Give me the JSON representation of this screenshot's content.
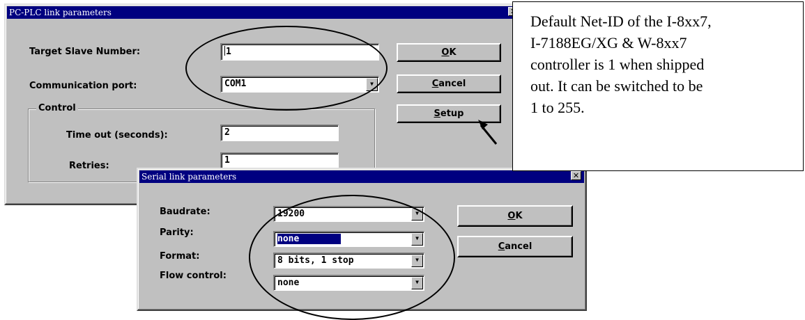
{
  "main_dialog": {
    "title": "PC-PLC link parameters",
    "target_slave_label": "Target Slave Number:",
    "target_slave_value": "1",
    "comm_port_label": "Communication port:",
    "comm_port_value": "COM1",
    "control_group_label": "Control",
    "timeout_label": "Time out (seconds):",
    "timeout_value": "2",
    "retries_label": "Retries:",
    "retries_value": "1",
    "ok_button": {
      "accel": "O",
      "rest": "K"
    },
    "cancel_button": {
      "accel": "C",
      "rest": "ancel"
    },
    "setup_button": {
      "accel": "S",
      "rest": "etup"
    }
  },
  "serial_dialog": {
    "title": "Serial link parameters",
    "baudrate_label": "Baudrate:",
    "baudrate_value": "19200",
    "parity_label": "Parity:",
    "parity_value": "none",
    "format_label": "Format:",
    "format_value": "8 bits, 1 stop",
    "flow_control_label": "Flow control:",
    "flow_control_value": "none",
    "ok_button": {
      "accel": "O",
      "rest": "K"
    },
    "cancel_button": {
      "accel": "C",
      "rest": "ancel"
    }
  },
  "callout": {
    "lines": [
      "Default Net-ID of the I-8xx7,",
      "I-7188EG/XG & W-8xx7",
      "controller is 1 when shipped",
      "out. It can be  switched to be",
      "1 to 255."
    ]
  },
  "glyphs": {
    "close": "✕",
    "dropdown": "▼"
  },
  "colors": {
    "titlebar": "#000080",
    "dialog_face": "#c0c0c0"
  }
}
